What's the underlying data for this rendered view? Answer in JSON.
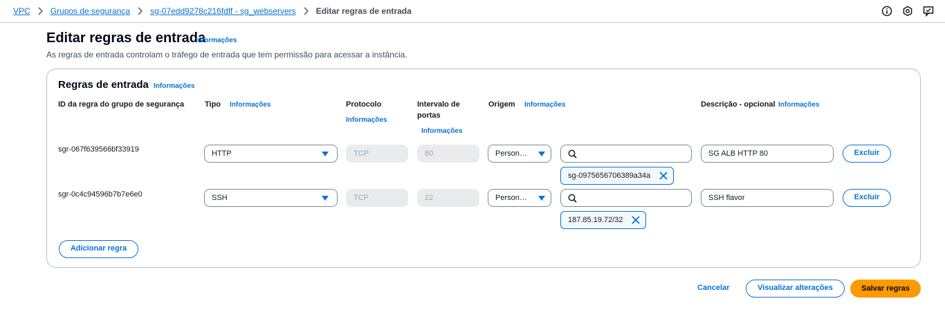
{
  "breadcrumb": {
    "items": [
      "VPC",
      "Grupos de segurança",
      "sg-07edd9278c216fdff - sg_webservers"
    ],
    "current": "Editar regras de entrada"
  },
  "top_icons": [
    "info-icon",
    "settings-icon",
    "feedback-icon"
  ],
  "page": {
    "title": "Editar regras de entrada",
    "info": "Informações",
    "subtitle": "As regras de entrada controlam o tráfego de entrada que tem permissão para acessar a instância."
  },
  "section": {
    "title": "Regras de entrada",
    "info": "Informações",
    "columns": {
      "rule_id": "ID da regra do grupo de segurança",
      "type": "Tipo",
      "type_info": "Informações",
      "protocol": "Protocolo",
      "protocol_info": "Informações",
      "port_range_line1": "Intervalo de",
      "port_range_line2": "portas",
      "port_range_info": "Informações",
      "source": "Origem",
      "source_info": "Informações",
      "description": "Descrição - opcional",
      "description_info": "Informações"
    },
    "rules": [
      {
        "id": "sgr-067f639566bf33919",
        "type": "HTTP",
        "protocol": "TCP",
        "port": "80",
        "source_type": "Person…",
        "search_value": "",
        "token": "sg-0975656706389a34a",
        "description": "SG ALB HTTP 80",
        "delete_label": "Excluir"
      },
      {
        "id": "sgr-0c4c94596b7b7e6e0",
        "type": "SSH",
        "protocol": "TCP",
        "port": "22",
        "source_type": "Person…",
        "search_value": "",
        "token": "187.85.19.72/32",
        "description": "SSH flavor",
        "delete_label": "Excluir"
      }
    ],
    "add_rule_label": "Adicionar regra"
  },
  "footer": {
    "cancel": "Cancelar",
    "preview": "Visualizar alterações",
    "save": "Salvar regras"
  },
  "colors": {
    "link": "#0972d3",
    "primary_button": "#ff9900",
    "border": "#7d8998",
    "disabled_bg": "#e9ebed"
  }
}
